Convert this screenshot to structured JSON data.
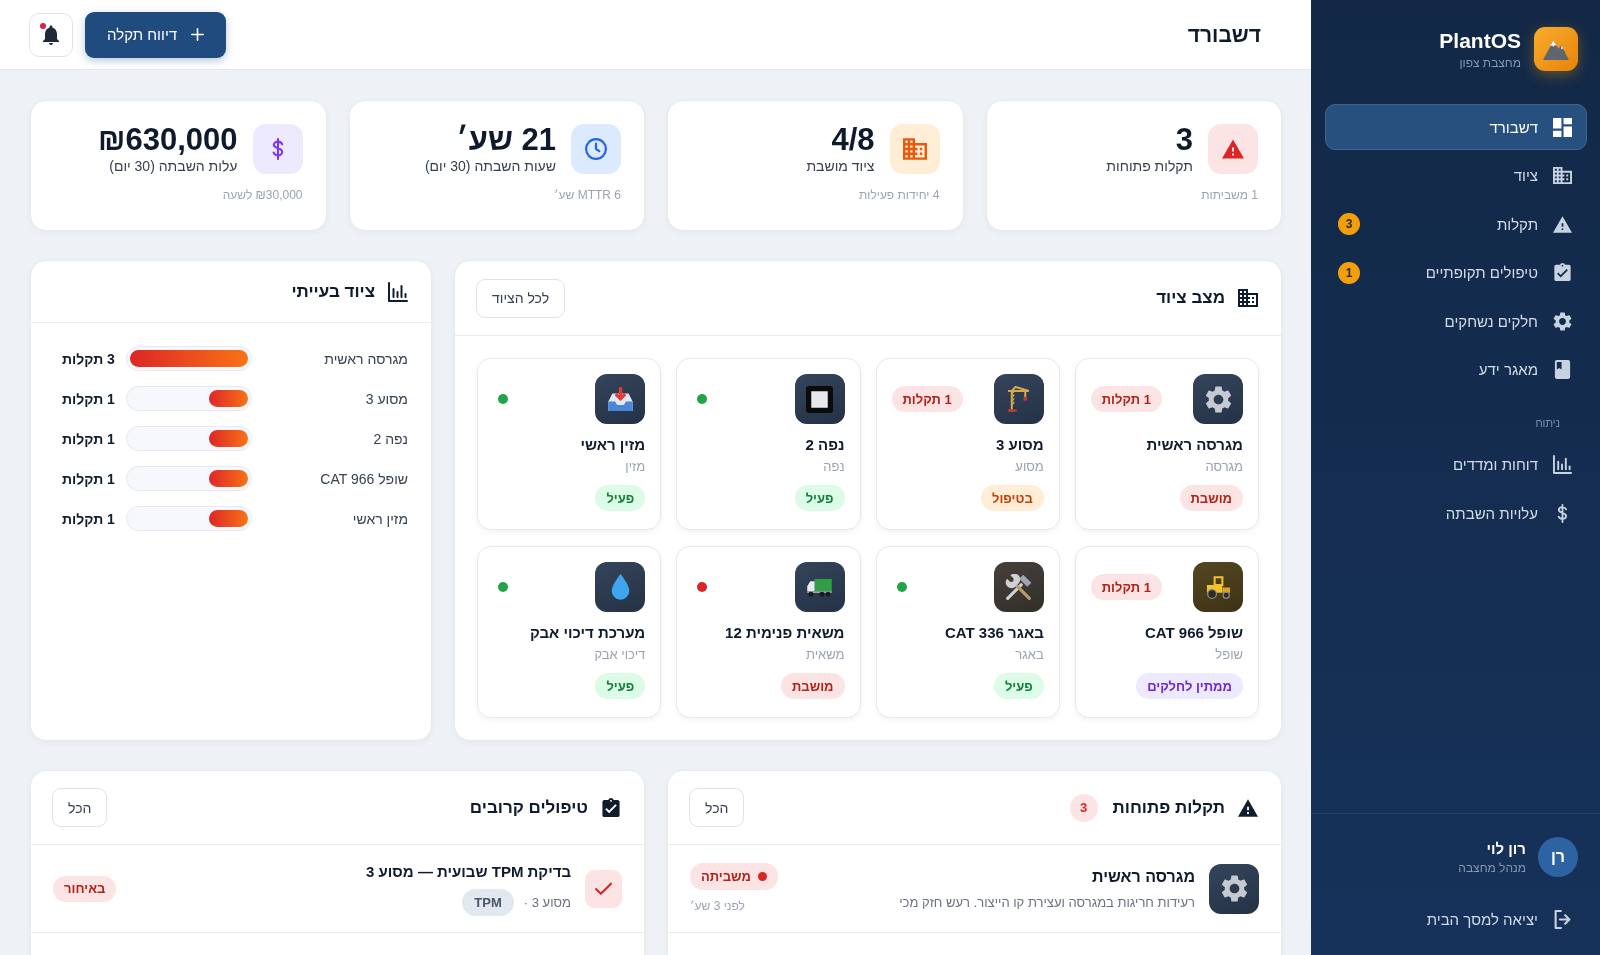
{
  "sidebar": {
    "brand": {
      "name": "PlantOS",
      "subtitle": "מחצבת צפון"
    },
    "items": [
      {
        "label": "דשבורד",
        "selected": true
      },
      {
        "label": "ציוד",
        "selected": false
      },
      {
        "label": "תקלות",
        "selected": false,
        "badge": "3"
      },
      {
        "label": "טיפולים תקופתיים",
        "selected": false,
        "badge": "1"
      },
      {
        "label": "חלקים נשחקים",
        "selected": false
      },
      {
        "label": "מאגר ידע",
        "selected": false
      }
    ],
    "section_title": "ניתוח",
    "section_items": [
      {
        "label": "דוחות ומדדים",
        "selected": false
      },
      {
        "label": "עלויות השבתה",
        "selected": false
      }
    ],
    "user": {
      "initials": "רן",
      "name": "רון לוי",
      "role": "מנהל מחצבה"
    },
    "logout": "יציאה למסך הבית"
  },
  "header": {
    "title": "דשבורד",
    "report_button": "דיווח תקלה",
    "notifications_unread": true
  },
  "stats": [
    {
      "value": "3",
      "label": "תקלות פתוחות",
      "note": "1 משביתות"
    },
    {
      "value": "4/8",
      "label": "ציוד מושבת",
      "note": "4 יחידות פעילות"
    },
    {
      "value": "21 שע׳",
      "label": "שעות השבתה (30 יום)",
      "note": "MTTR 6 שע׳"
    },
    {
      "value": "₪630,000",
      "label": "עלות השבתה (30 יום)",
      "note": "₪30,000 לשעה"
    }
  ],
  "equipment_status": {
    "title": "מצב ציוד",
    "all_button": "לכל הציוד",
    "items": [
      {
        "name": "מגרסה ראשית",
        "type": "מגרסה",
        "status": {
          "label": "מושבת",
          "kind": "down"
        },
        "faults": "1 תקלות"
      },
      {
        "name": "מסוע 3",
        "type": "מסוע",
        "status": {
          "label": "בטיפול",
          "kind": "repair"
        },
        "faults": "1 תקלות"
      },
      {
        "name": "נפה 2",
        "type": "נפה",
        "status": {
          "label": "פעיל",
          "kind": "active"
        },
        "color": "#22a34a"
      },
      {
        "name": "מזין ראשי",
        "type": "מזין",
        "status": {
          "label": "פעיל",
          "kind": "active"
        },
        "color": "#22a34a"
      },
      {
        "name": "שופל CAT 966",
        "type": "שופל",
        "status": {
          "label": "ממתין לחלקים",
          "kind": "waiting"
        },
        "faults": "1 תקלות"
      },
      {
        "name": "באגר CAT 336",
        "type": "באגר",
        "status": {
          "label": "פעיל",
          "kind": "active"
        },
        "color": "#22a34a"
      },
      {
        "name": "משאית פנימית 12",
        "type": "משאית",
        "status": {
          "label": "מושבת",
          "kind": "down"
        },
        "color": "#dc2626"
      },
      {
        "name": "מערכת דיכוי אבק",
        "type": "דיכוי אבק",
        "status": {
          "label": "פעיל",
          "kind": "active"
        },
        "color": "#22a34a"
      }
    ]
  },
  "problem_equipment": {
    "title": "ציוד בעייתי",
    "items": [
      {
        "name": "מגרסה ראשית",
        "level": 1,
        "value": "3 תקלות"
      },
      {
        "name": "מסוע 3",
        "level": 0.33,
        "value": "1 תקלות"
      },
      {
        "name": "נפה 2",
        "level": 0.33,
        "value": "1 תקלות"
      },
      {
        "name": "שופל CAT 966",
        "level": 0.33,
        "value": "1 תקלות"
      },
      {
        "name": "מזין ראשי",
        "level": 0.33,
        "value": "1 תקלות"
      }
    ]
  },
  "open_faults": {
    "title": "תקלות פתוחות",
    "count": "3",
    "all_button": "הכל",
    "items": [
      {
        "name": "מגרסה ראשית",
        "description": "רעידות חריגות במגרסה ועצירת קו הייצור. רעש חזק מכי",
        "severity": {
          "label": "משביתה",
          "kind": "critical"
        },
        "time": "לפני 3 שע׳"
      }
    ]
  },
  "upcoming_maintenance": {
    "title": "טיפולים קרובים",
    "all_button": "הכל",
    "items": [
      {
        "title": "בדיקת TPM שבועית — מסוע 3",
        "equipment": "מסוע 3 ·",
        "tag": "TPM",
        "status": {
          "label": "באיחור",
          "kind": "overdue"
        }
      }
    ]
  }
}
